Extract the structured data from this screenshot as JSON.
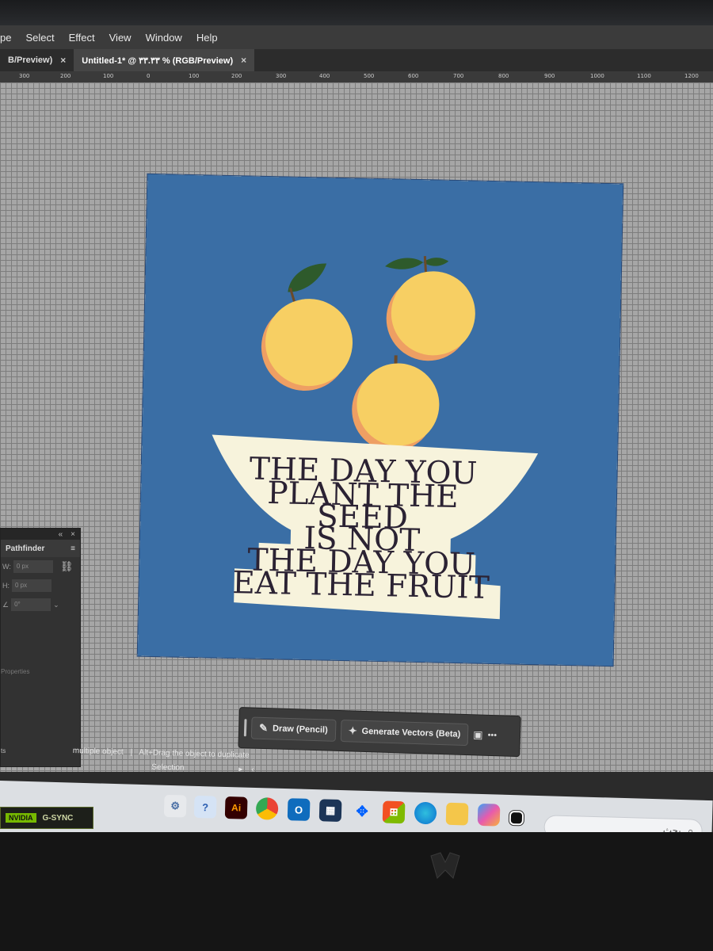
{
  "menu": [
    "pe",
    "Select",
    "Effect",
    "View",
    "Window",
    "Help"
  ],
  "tabs": [
    {
      "label": "B/Preview)",
      "close": "×",
      "active": false
    },
    {
      "label": "Untitled-1* @ ٣٣.٣٣ % (RGB/Preview)",
      "close": "×",
      "active": true
    }
  ],
  "ruler_ticks": [
    "300",
    "200",
    "100",
    "0",
    "100",
    "200",
    "300",
    "400",
    "500",
    "600",
    "700",
    "800",
    "900",
    "1000",
    "1100",
    "1200"
  ],
  "poster": {
    "background_color": "#3a6ea5",
    "bowl_color": "#f7f3dc",
    "fruit_color": "#f7cf63",
    "fruit_shadow_color": "#ee9f63",
    "leaf_color": "#2e5a2b",
    "text_color": "#2b2233",
    "lines": [
      "THE DAY YOU",
      "PLANT THE",
      "SEED",
      "IS NOT",
      "THE DAY YOU",
      "EAT THE FRUIT"
    ]
  },
  "pathfinder": {
    "title": "Pathfinder",
    "collapse": "«",
    "close": "×",
    "w_label": "W:",
    "w_value": "0 px",
    "h_label": "H:",
    "h_value": "0 px",
    "angle_value": "0°",
    "properties_label": "Properties",
    "footer_label": "ts"
  },
  "context_toolbar": {
    "draw_label": "Draw (Pencil)",
    "generate_label": "Generate Vectors (Beta)",
    "more_label": "•••"
  },
  "status": {
    "hint_left": "multiple object",
    "separator": "|",
    "hint_right": "Alt+Drag the object to duplicate",
    "tool_name": "Selection"
  },
  "taskbar": {
    "apps": [
      "Settings",
      "Copilot",
      "Illustrator",
      "Chrome",
      "Outlook",
      "Store",
      "Dropbox",
      "Microsoft 365",
      "Edge",
      "File Explorer",
      "Copilot",
      "Task View"
    ],
    "illustrator_label": "Ai",
    "search_placeholder": "بحث"
  },
  "laptop": {
    "gsync_brand": "NVIDIA",
    "gsync_label": "G-SYNC"
  }
}
